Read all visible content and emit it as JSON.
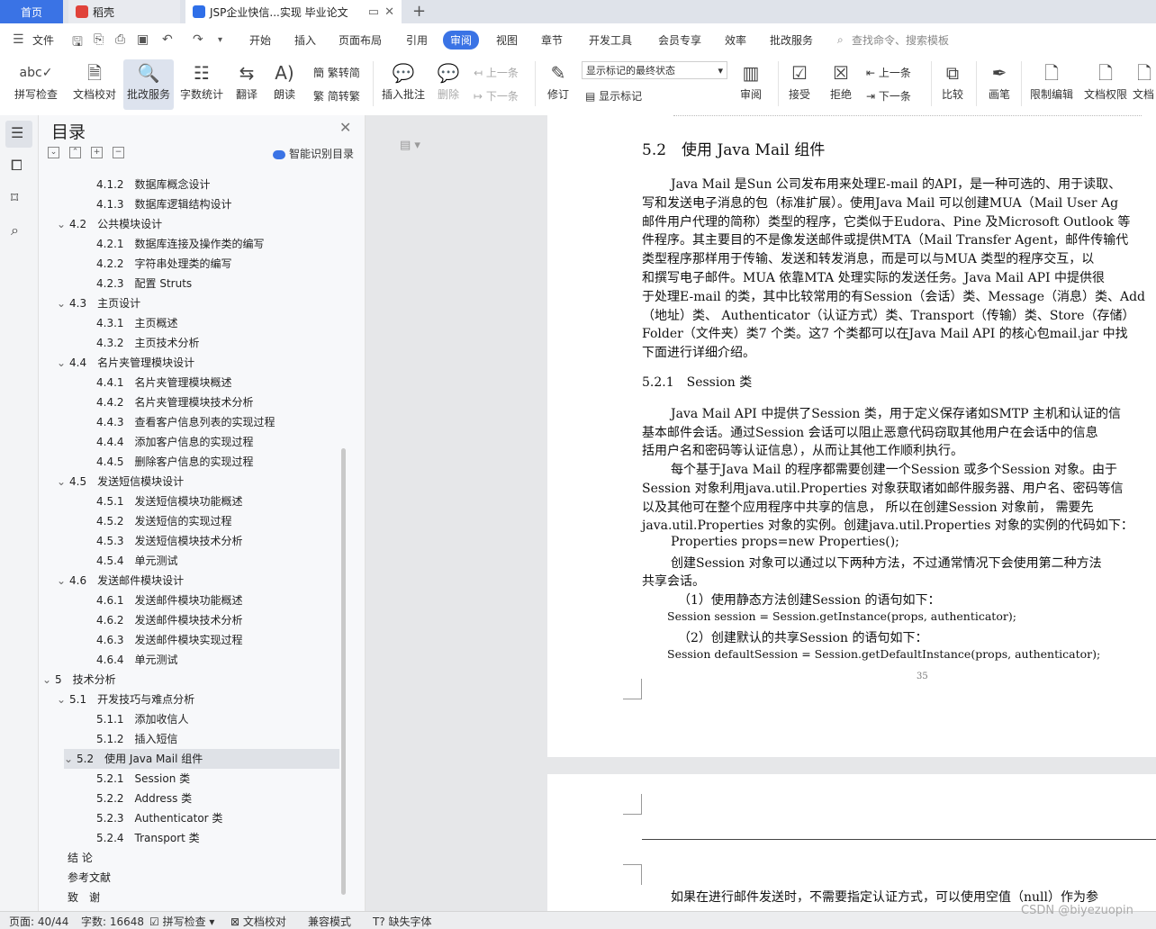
{
  "tabs": {
    "home": "首页",
    "daoke": "稻壳",
    "doc": "JSP企业快信...实现 毕业论文"
  },
  "menu": {
    "file": "文件",
    "items": [
      "开始",
      "插入",
      "页面布局",
      "引用",
      "审阅",
      "视图",
      "章节",
      "开发工具",
      "会员专享",
      "效率",
      "批改服务"
    ],
    "active_index": 4,
    "search": "查找命令、搜索模板"
  },
  "ribbon": {
    "spell": "拼写检查",
    "proof": "文档校对",
    "correct": "批改服务",
    "wordcount": "字数统计",
    "translate": "翻译",
    "read": "朗读",
    "t2s": "繁转简",
    "s2t": "简转繁",
    "insert_comment": "插入批注",
    "delete": "删除",
    "prev_comment": "上一条",
    "next_comment": "下一条",
    "revise": "修订",
    "mark_state": "显示标记的最终状态",
    "show_marks": "显示标记",
    "review": "审阅",
    "accept": "接受",
    "reject": "拒绝",
    "prev": "上一条",
    "next": "下一条",
    "compare": "比较",
    "pen": "画笔",
    "restrict": "限制编辑",
    "doc_rights": "文档权限",
    "doc_more": "文档"
  },
  "toc": {
    "title": "目录",
    "smart": "智能识别目录",
    "items": [
      {
        "text": "4.1.2　数据库概念设计",
        "level": 3,
        "caret": false
      },
      {
        "text": "4.1.3　数据库逻辑结构设计",
        "level": 3,
        "caret": false
      },
      {
        "text": "4.2　公共模块设计",
        "level": 2,
        "caret": true
      },
      {
        "text": "4.2.1　数据库连接及操作类的编写",
        "level": 3,
        "caret": false
      },
      {
        "text": "4.2.2　字符串处理类的编写",
        "level": 3,
        "caret": false
      },
      {
        "text": "4.2.3　配置 Struts",
        "level": 3,
        "caret": false
      },
      {
        "text": "4.3　主页设计",
        "level": 2,
        "caret": true
      },
      {
        "text": "4.3.1　主页概述",
        "level": 3,
        "caret": false
      },
      {
        "text": "4.3.2　主页技术分析",
        "level": 3,
        "caret": false
      },
      {
        "text": "4.4　名片夹管理模块设计",
        "level": 2,
        "caret": true
      },
      {
        "text": "4.4.1　名片夹管理模块概述",
        "level": 3,
        "caret": false
      },
      {
        "text": "4.4.2　名片夹管理模块技术分析",
        "level": 3,
        "caret": false
      },
      {
        "text": "4.4.3　查看客户信息列表的实现过程",
        "level": 3,
        "caret": false
      },
      {
        "text": "4.4.4　添加客户信息的实现过程",
        "level": 3,
        "caret": false
      },
      {
        "text": "4.4.5　删除客户信息的实现过程",
        "level": 3,
        "caret": false
      },
      {
        "text": "4.5　发送短信模块设计",
        "level": 2,
        "caret": true
      },
      {
        "text": "4.5.1　发送短信模块功能概述",
        "level": 3,
        "caret": false
      },
      {
        "text": "4.5.2　发送短信的实现过程",
        "level": 3,
        "caret": false
      },
      {
        "text": "4.5.3　发送短信模块技术分析",
        "level": 3,
        "caret": false
      },
      {
        "text": "4.5.4　单元测试",
        "level": 3,
        "caret": false
      },
      {
        "text": "4.6　发送邮件模块设计",
        "level": 2,
        "caret": true
      },
      {
        "text": "4.6.1　发送邮件模块功能概述",
        "level": 3,
        "caret": false
      },
      {
        "text": "4.6.2　发送邮件模块技术分析",
        "level": 3,
        "caret": false
      },
      {
        "text": "4.6.3　发送邮件模块实现过程",
        "level": 3,
        "caret": false
      },
      {
        "text": "4.6.4　单元测试",
        "level": 3,
        "caret": false
      },
      {
        "text": "5　技术分析",
        "level": 1,
        "caret": true
      },
      {
        "text": "5.1　开发技巧与难点分析",
        "level": 2,
        "caret": true
      },
      {
        "text": "5.1.1　添加收信人",
        "level": 3,
        "caret": false
      },
      {
        "text": "5.1.2　插入短信",
        "level": 3,
        "caret": false
      },
      {
        "text": "5.2　使用 Java Mail  组件",
        "level": 2,
        "caret": true,
        "selected": true
      },
      {
        "text": "5.2.1　Session  类",
        "level": 3,
        "caret": false
      },
      {
        "text": "5.2.2　Address  类",
        "level": 3,
        "caret": false
      },
      {
        "text": "5.2.3　Authenticator  类",
        "level": 3,
        "caret": false
      },
      {
        "text": "5.2.4　Transport  类",
        "level": 3,
        "caret": false
      },
      {
        "text": "结 论",
        "level": 0,
        "caret": false
      },
      {
        "text": "参考文献",
        "level": 0,
        "caret": false
      },
      {
        "text": "致　谢",
        "level": 0,
        "caret": false
      }
    ]
  },
  "document": {
    "heading": "5.2　使用 Java Mail  组件",
    "para1": [
      "Java Mail  是Sun  公司发布用来处理E-mail  的API，是一种可选的、用于读取、",
      "写和发送电子消息的包（标准扩展）。使用Java Mail  可以创建MUA（Mail User Ag",
      "邮件用户代理的简称）类型的程序，它类似于Eudora、Pine  及Microsoft Outlook  等",
      "件程序。其主要目的不是像发送邮件或提供MTA（Mail Transfer Agent，邮件传输代",
      "类型程序那样用于传输、发送和转发消息，而是可以与MUA  类型的程序交互，以",
      "和撰写电子邮件。MUA  依靠MTA  处理实际的发送任务。Java Mail API  中提供很",
      "于处理E-mail  的类，其中比较常用的有Session（会话）类、Message（消息）类、Add",
      "（地址）类、  Authenticator（认证方式）类、Transport（传输）类、Store（存储）",
      "Folder（文件夹）类7  个类。这7  个类都可以在Java Mail API  的核心包mail.jar  中找",
      "下面进行详细介绍。"
    ],
    "subheading": "5.2.1　Session  类",
    "para2": [
      "Java Mail API  中提供了Session  类，用于定义保存诸如SMTP  主机和认证的信",
      "基本邮件会话。通过Session  会话可以阻止恶意代码窃取其他用户在会话中的信息",
      "括用户名和密码等认证信息），从而让其他工作顺利执行。",
      "每个基于Java Mail  的程序都需要创建一个Session  或多个Session  对象。由于",
      "Session  对象利用java.util.Properties  对象获取诸如邮件服务器、用户名、密码等信",
      "以及其他可在整个应用程序中共享的信息，  所以在创建Session  对象前，  需要先",
      "java.util.Properties  对象的实例。创建java.util.Properties  对象的实例的代码如下：",
      "Properties props=new Properties();",
      "创建Session  对象可以通过以下两种方法，不过通常情况下会使用第二种方法",
      "共享会话。",
      "（1）使用静态方法创建Session  的语句如下：",
      "Session session = Session.getInstance(props, authenticator);",
      "（2）创建默认的共享Session  的语句如下：",
      "Session defaultSession = Session.getDefaultInstance(props, authenticator);"
    ],
    "page_number": "35",
    "page2_text": "如果在进行邮件发送时，不需要指定认证方式，可以使用空值（null）作为参"
  },
  "status": {
    "page": "页面: 40/44",
    "words": "字数: 16648",
    "spell": "拼写检查",
    "proof": "文档校对",
    "compat": "兼容模式",
    "missing_font": "缺失字体"
  },
  "watermark": "CSDN @biyezuopin"
}
